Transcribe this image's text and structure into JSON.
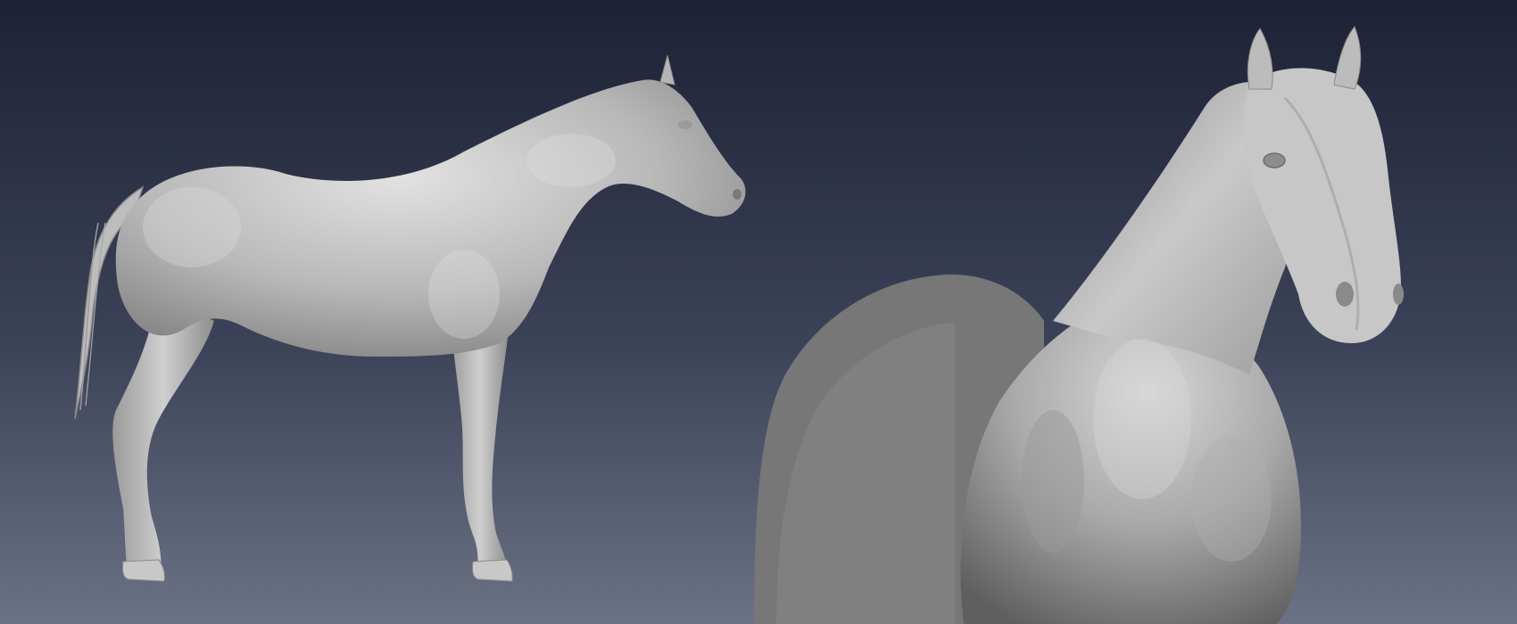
{
  "scene": {
    "background_top": "#1d2236",
    "background_bottom": "#6b7286",
    "model_color": "#c4c4c4",
    "model_shadow": "#6d6d6d",
    "views": [
      {
        "name": "side-view",
        "subject": "horse-sculpt"
      },
      {
        "name": "three-quarter-view",
        "subject": "horse-sculpt"
      }
    ]
  }
}
